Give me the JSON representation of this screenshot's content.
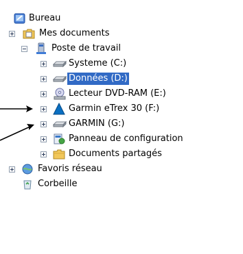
{
  "tree": {
    "root": {
      "label": "Bureau",
      "icon": "desktop-icon"
    },
    "my_documents": {
      "label": "Mes documents",
      "icon": "documents-folder-icon",
      "expander": "plus"
    },
    "my_computer": {
      "label": "Poste de travail",
      "icon": "computer-icon",
      "expander": "minus"
    },
    "drives": [
      {
        "label": "Systeme (C:)",
        "icon": "hard-drive-icon",
        "expander": "plus",
        "selected": false
      },
      {
        "label": "Données (D:)",
        "icon": "hard-drive-icon",
        "expander": "plus",
        "selected": true
      },
      {
        "label": "Lecteur DVD-RAM (E:)",
        "icon": "dvd-drive-icon",
        "expander": "plus",
        "selected": false
      },
      {
        "label": "Garmin eTrex 30 (F:)",
        "icon": "garmin-device-icon",
        "expander": "plus",
        "selected": false
      },
      {
        "label": "GARMIN (G:)",
        "icon": "hard-drive-icon",
        "expander": "plus",
        "selected": false
      },
      {
        "label": "Panneau de configuration",
        "icon": "control-panel-icon",
        "expander": "plus",
        "selected": false
      },
      {
        "label": "Documents partagés",
        "icon": "shared-folder-icon",
        "expander": "plus",
        "selected": false
      }
    ],
    "network": {
      "label": "Favoris réseau",
      "icon": "network-icon",
      "expander": "plus"
    },
    "recycle_bin": {
      "label": "Corbeille",
      "icon": "recycle-bin-icon"
    }
  },
  "colors": {
    "selection": "#316ac5",
    "arrow": "#000000"
  }
}
